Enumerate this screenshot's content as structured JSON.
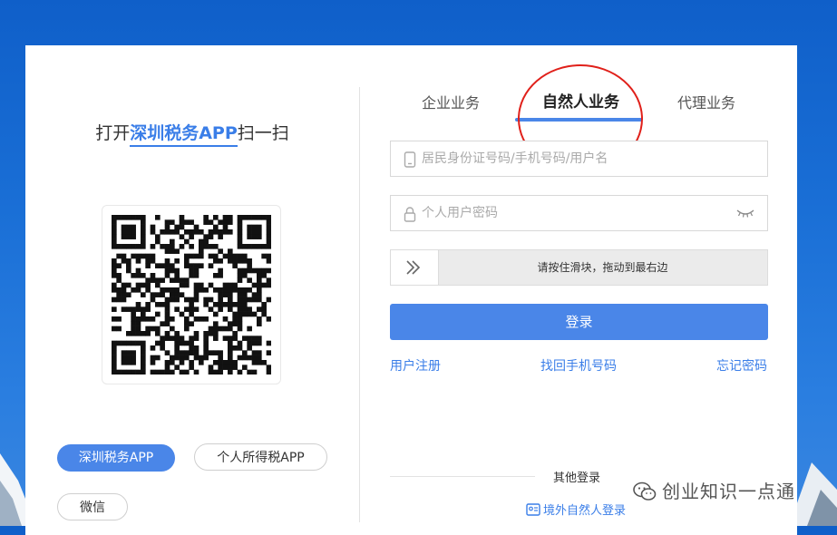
{
  "left": {
    "scan_prefix": "打开",
    "scan_app": "深圳税务APP",
    "scan_suffix": "扫一扫",
    "buttons": {
      "shenzhen_app": "深圳税务APP",
      "personal_tax_app": "个人所得税APP",
      "wechat": "微信"
    }
  },
  "tabs": {
    "enterprise": "企业业务",
    "natural_person": "自然人业务",
    "agent": "代理业务"
  },
  "form": {
    "username_placeholder": "居民身份证号码/手机号码/用户名",
    "password_placeholder": "个人用户密码",
    "slider_hint": "请按住滑块，拖动到最右边",
    "login_label": "登录"
  },
  "links": {
    "register": "用户注册",
    "recover_phone": "找回手机号码",
    "forgot_password": "忘记密码"
  },
  "other": {
    "label": "其他登录",
    "overseas": "境外自然人登录"
  },
  "watermark": "创业知识一点通",
  "colors": {
    "accent": "#4a86e8",
    "link": "#3a7ee8",
    "annotation_circle": "#e0201a"
  }
}
